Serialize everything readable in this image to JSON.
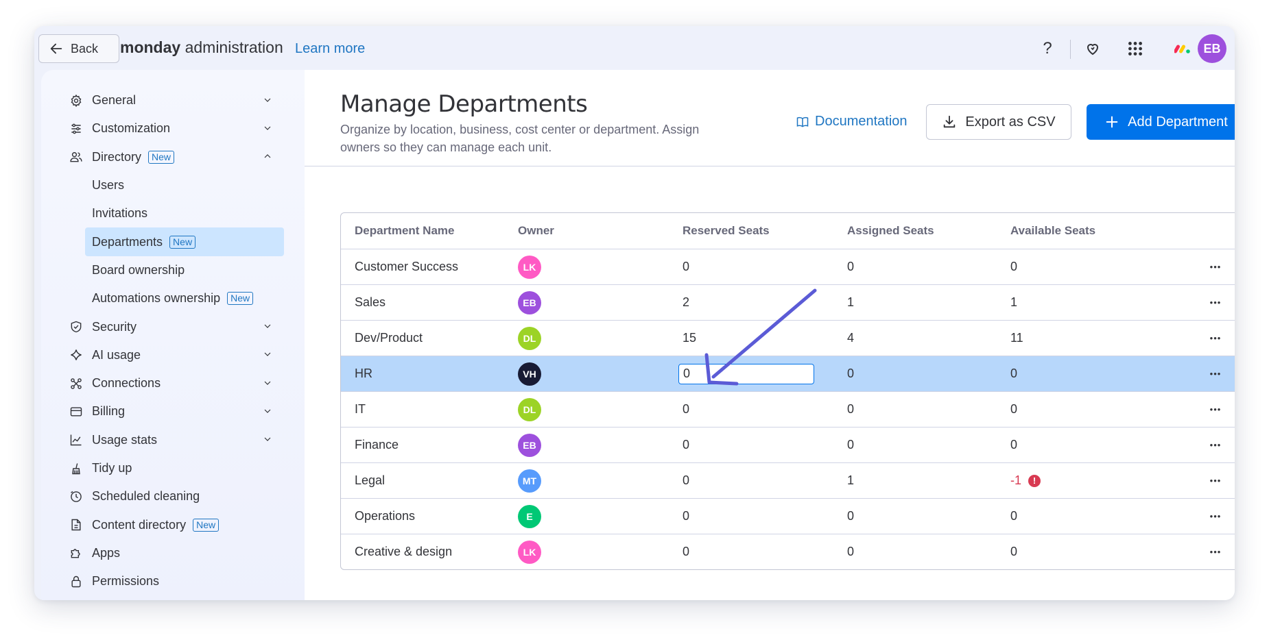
{
  "topbar": {
    "back_label": "Back",
    "brand_bold": "monday",
    "brand_rest": " administration",
    "learn_more": "Learn more",
    "help_symbol": "?",
    "user_initials": "EB",
    "user_color": "#9d50dd"
  },
  "sidebar": {
    "items": [
      {
        "label": "General",
        "icon": "gear-icon",
        "chevron": "down"
      },
      {
        "label": "Customization",
        "icon": "sliders-icon",
        "chevron": "down"
      },
      {
        "label": "Directory",
        "icon": "people-icon",
        "chevron": "up",
        "badge": "New"
      },
      {
        "label": "Users"
      },
      {
        "label": "Invitations"
      },
      {
        "label": "Departments",
        "badge": "New",
        "active": true
      },
      {
        "label": "Board ownership"
      },
      {
        "label": "Automations ownership",
        "badge": "New"
      },
      {
        "label": "Security",
        "icon": "shield-icon",
        "chevron": "down"
      },
      {
        "label": "AI usage",
        "icon": "sparkle-icon",
        "chevron": "down"
      },
      {
        "label": "Connections",
        "icon": "connections-icon",
        "chevron": "down"
      },
      {
        "label": "Billing",
        "icon": "card-icon",
        "chevron": "down"
      },
      {
        "label": "Usage stats",
        "icon": "chart-icon",
        "chevron": "down"
      },
      {
        "label": "Tidy up",
        "icon": "broom-icon"
      },
      {
        "label": "Scheduled cleaning",
        "icon": "clock-icon"
      },
      {
        "label": "Content directory",
        "icon": "content-icon",
        "badge": "New"
      },
      {
        "label": "Apps",
        "icon": "puzzle-icon"
      },
      {
        "label": "Permissions",
        "icon": "lock-icon"
      }
    ]
  },
  "main": {
    "title": "Manage Departments",
    "subtitle": "Organize by location, business, cost center or department. Assign owners so they can manage each unit.",
    "documentation": "Documentation",
    "export_label": "Export as CSV",
    "add_label": "Add Department"
  },
  "table": {
    "headers": [
      "Department Name",
      "Owner",
      "Reserved Seats",
      "Assigned Seats",
      "Available Seats"
    ],
    "rows": [
      {
        "name": "Customer Success",
        "owner": "LK",
        "owner_color": "#ff5ac4",
        "reserved": "0",
        "assigned": "0",
        "available": "0"
      },
      {
        "name": "Sales",
        "owner": "EB",
        "owner_color": "#9d50dd",
        "reserved": "2",
        "assigned": "1",
        "available": "1"
      },
      {
        "name": "Dev/Product",
        "owner": "DL",
        "owner_color": "#9cd326",
        "reserved": "15",
        "assigned": "4",
        "available": "11"
      },
      {
        "name": "HR",
        "owner": "VH",
        "owner_color": "#181b34",
        "reserved": "0",
        "assigned": "0",
        "available": "0",
        "selected": true,
        "editing": true
      },
      {
        "name": "IT",
        "owner": "DL",
        "owner_color": "#9cd326",
        "reserved": "0",
        "assigned": "0",
        "available": "0"
      },
      {
        "name": "Finance",
        "owner": "EB",
        "owner_color": "#9d50dd",
        "reserved": "0",
        "assigned": "0",
        "available": "0"
      },
      {
        "name": "Legal",
        "owner": "MT",
        "owner_color": "#579bfc",
        "reserved": "0",
        "assigned": "1",
        "available": "-1",
        "error": true
      },
      {
        "name": "Operations",
        "owner": "E",
        "owner_color": "#00c875",
        "reserved": "0",
        "assigned": "0",
        "available": "0"
      },
      {
        "name": "Creative & design",
        "owner": "LK",
        "owner_color": "#ff5ac4",
        "reserved": "0",
        "assigned": "0",
        "available": "0"
      }
    ],
    "more_symbol": "•••"
  },
  "colors": {
    "accent": "#0073ea",
    "selected_row": "#b7d7fb",
    "active_nav": "#cce5ff",
    "annotation_arrow": "#5b5bd6",
    "error": "#d83a52"
  }
}
